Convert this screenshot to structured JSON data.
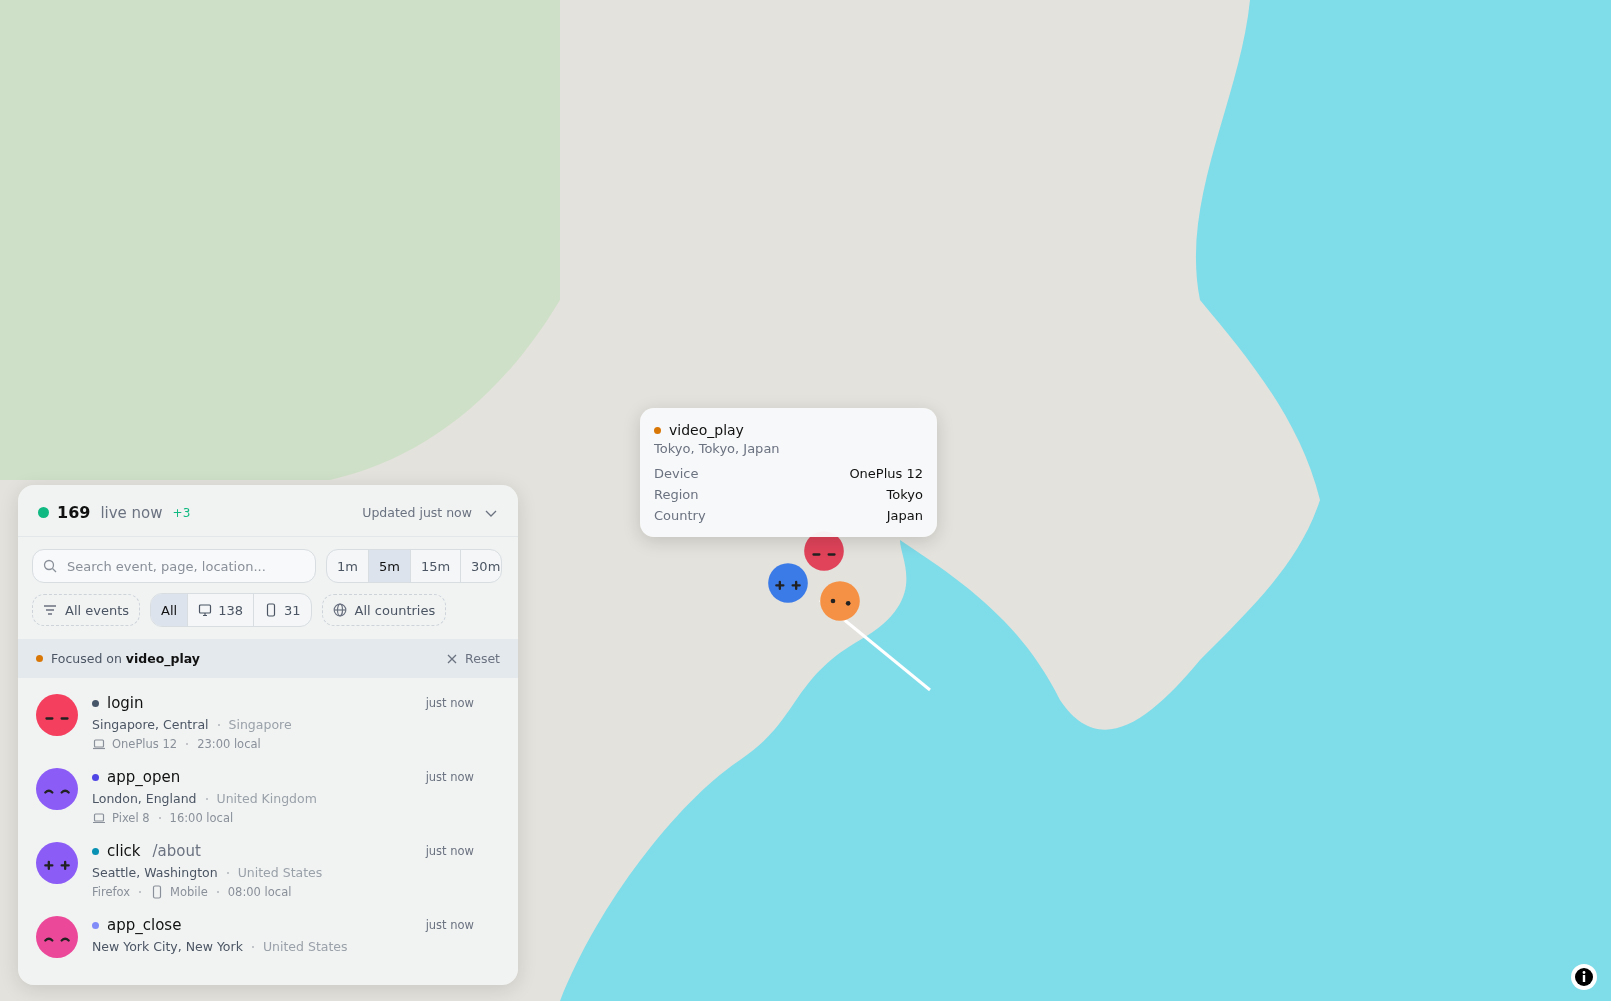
{
  "map": {
    "markers": [
      {
        "color": "#e0435a",
        "kind": "dash"
      },
      {
        "color": "#3b7be8",
        "kind": "plus"
      },
      {
        "color": "#f59145",
        "kind": "dot"
      }
    ],
    "tooltip": {
      "event": "video_play",
      "color": "#d97706",
      "location": "Tokyo, Tokyo, Japan",
      "rows": [
        {
          "label": "Device",
          "value": "OnePlus 12"
        },
        {
          "label": "Region",
          "value": "Tokyo"
        },
        {
          "label": "Country",
          "value": "Japan"
        }
      ]
    }
  },
  "panel": {
    "count": "169",
    "count_label": "live now",
    "delta": "+3",
    "updated": "Updated just now",
    "search": {
      "placeholder": "Search event, page, location..."
    },
    "ranges": [
      {
        "label": "1m",
        "selected": false
      },
      {
        "label": "5m",
        "selected": true
      },
      {
        "label": "15m",
        "selected": false
      },
      {
        "label": "30m",
        "selected": false
      }
    ],
    "event_filter": "All events",
    "devices": [
      {
        "label": "All",
        "kind": "all",
        "selected": true
      },
      {
        "label": "138",
        "kind": "desktop",
        "selected": false
      },
      {
        "label": "31",
        "kind": "phone",
        "selected": false
      }
    ],
    "country_filter": "All countries",
    "focus": {
      "prefix": "Focused on",
      "event": "video_play",
      "color": "#d97706",
      "reset": "Reset"
    },
    "events": [
      {
        "name": "login",
        "color": "#475569",
        "avatar": {
          "color": "#f43f5e",
          "kind": "dash"
        },
        "place": "Singapore, Central",
        "country": "Singapore",
        "time": "just now",
        "meta": [
          {
            "kind": "laptop",
            "text": "OnePlus 12"
          },
          {
            "kind": "text",
            "text": "23:00 local"
          }
        ]
      },
      {
        "name": "app_open",
        "color": "#4f46e5",
        "avatar": {
          "color": "#8b5cf6",
          "kind": "arc"
        },
        "place": "London, England",
        "country": "United Kingdom",
        "time": "just now",
        "meta": [
          {
            "kind": "laptop",
            "text": "Pixel 8"
          },
          {
            "kind": "text",
            "text": "16:00 local"
          }
        ]
      },
      {
        "name": "click",
        "path": "/about",
        "color": "#0891b2",
        "avatar": {
          "color": "#8b5cf6",
          "kind": "plus"
        },
        "place": "Seattle, Washington",
        "country": "United States",
        "time": "just now",
        "meta": [
          {
            "kind": "text",
            "text": "Firefox"
          },
          {
            "kind": "phone",
            "text": "Mobile"
          },
          {
            "kind": "text",
            "text": "08:00 local"
          }
        ]
      },
      {
        "name": "app_close",
        "color": "#818cf8",
        "avatar": {
          "color": "#ec4899",
          "kind": "arc"
        },
        "place": "New York City, New York",
        "country": "United States",
        "time": "just now"
      }
    ]
  }
}
